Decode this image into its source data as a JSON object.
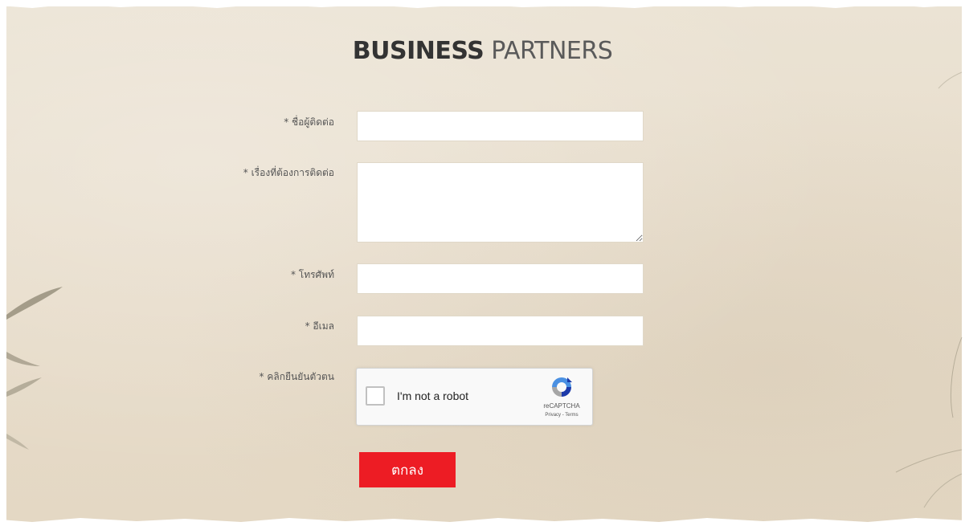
{
  "header": {
    "title_strong": "BUSINESS",
    "title_light": "PARTNERS"
  },
  "form": {
    "fields": [
      {
        "label": "* ชื่อผู้ติดต่อ",
        "value": "",
        "type": "text"
      },
      {
        "label": "* เรื่องที่ต้องการติดต่อ",
        "value": "",
        "type": "textarea"
      },
      {
        "label": "* โทรศัพท์",
        "value": "",
        "type": "text"
      },
      {
        "label": "* อีเมล",
        "value": "",
        "type": "text"
      }
    ],
    "captcha": {
      "label": "* คลิกยืนยันตัวตน",
      "text": "I'm not a robot",
      "brand": "reCAPTCHA",
      "privacy": "Privacy",
      "separator": " - ",
      "terms": "Terms",
      "checked": false
    },
    "submit_label": "ตกลง"
  },
  "colors": {
    "accent": "#ed1c24",
    "background": "#e8dfce",
    "text": "#555555"
  },
  "icons": {
    "captcha": "recaptcha-logo-icon",
    "decor": "bamboo-leaf-icon"
  }
}
